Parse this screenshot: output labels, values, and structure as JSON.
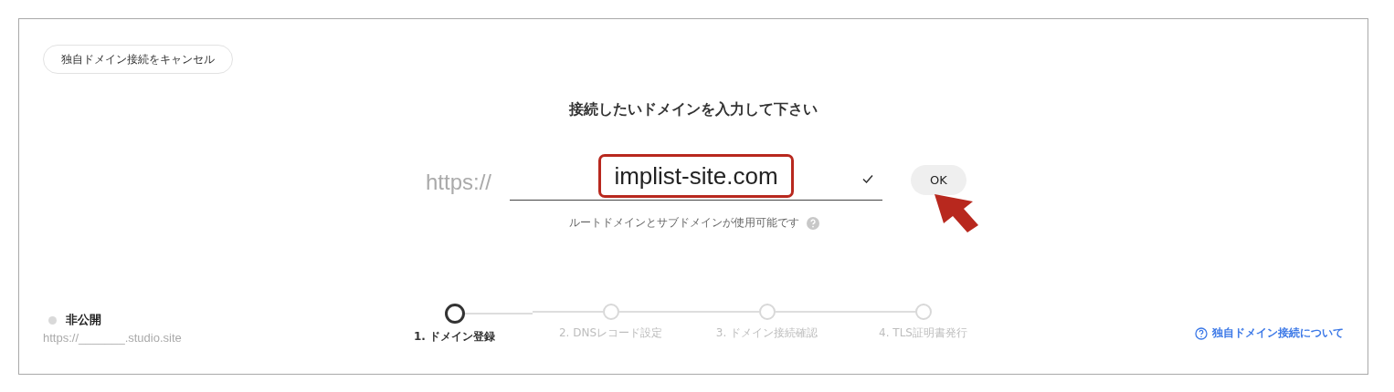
{
  "cancel_button": "独自ドメイン接続をキャンセル",
  "heading": "接続したいドメインを入力して下さい",
  "domain_form": {
    "prefix": "https://",
    "value": "implist-site.com",
    "value_highlighted": true,
    "valid": true,
    "ok_button": "OK",
    "ok_arrow": true,
    "hint": "ルートドメインとサブドメインが使用可能です"
  },
  "status": {
    "label": "非公開",
    "published": false,
    "url": "https://_______.studio.site"
  },
  "steps": [
    {
      "label": "1. ドメイン登録",
      "selected": true
    },
    {
      "label": "2. DNSレコード設定",
      "selected": false
    },
    {
      "label": "3. ドメイン接続確認",
      "selected": false
    },
    {
      "label": "4. TLS証明書発行",
      "selected": false
    }
  ],
  "help_link": "独自ドメイン接続について"
}
